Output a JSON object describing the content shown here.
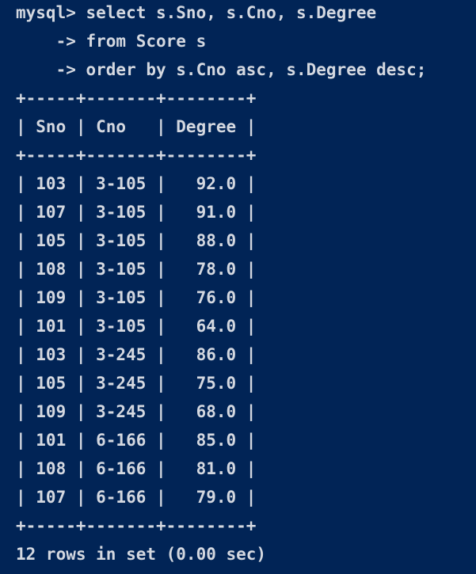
{
  "terminal": {
    "lines": [
      "mysql> select s.Sno, s.Cno, s.Degree",
      "    -> from Score s",
      "    -> order by s.Cno asc, s.Degree desc;",
      "+-----+-------+--------+",
      "| Sno | Cno   | Degree |",
      "+-----+-------+--------+",
      "| 103 | 3-105 |   92.0 |",
      "| 107 | 3-105 |   91.0 |",
      "| 105 | 3-105 |   88.0 |",
      "| 108 | 3-105 |   78.0 |",
      "| 109 | 3-105 |   76.0 |",
      "| 101 | 3-105 |   64.0 |",
      "| 103 | 3-245 |   86.0 |",
      "| 105 | 3-245 |   75.0 |",
      "| 109 | 3-245 |   68.0 |",
      "| 101 | 6-166 |   85.0 |",
      "| 108 | 6-166 |   81.0 |",
      "| 107 | 6-166 |   79.0 |",
      "+-----+-------+--------+",
      "12 rows in set (0.00 sec)"
    ]
  },
  "colors": {
    "background": "#012456",
    "text": "#d4d8e0"
  }
}
